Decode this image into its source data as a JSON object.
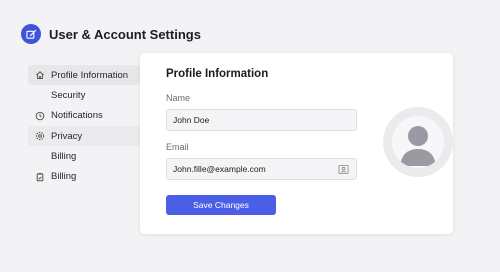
{
  "header": {
    "title": "User & Account Settings",
    "logo_icon": "edit-icon",
    "accent": "#3f55d9"
  },
  "sidebar": {
    "items": [
      {
        "label": "Profile Information",
        "icon": "home-icon",
        "state": "active"
      },
      {
        "label": "Security",
        "icon": ""
      },
      {
        "label": "Notifications",
        "icon": "clock-icon"
      },
      {
        "label": "Privacy",
        "icon": "gear-icon",
        "state": "hover"
      },
      {
        "label": "Billing",
        "icon": ""
      },
      {
        "label": "Billing",
        "icon": "clipboard-icon"
      }
    ]
  },
  "card": {
    "title": "Profile Information",
    "name_label": "Name",
    "name_value": "John Doe",
    "email_label": "Email",
    "email_value": "John.fille@example.com",
    "email_icon": "contact-card-icon",
    "save_label": "Save Changes",
    "button_color": "#4a5fe6",
    "avatar_icon": "user-avatar-icon"
  }
}
